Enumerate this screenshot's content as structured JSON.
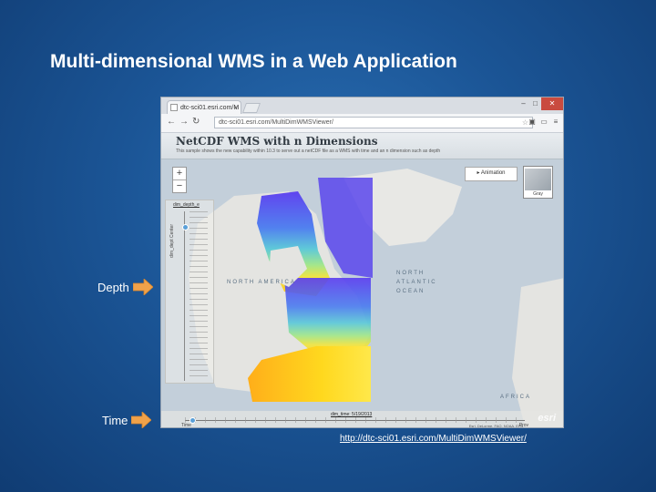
{
  "slide": {
    "title": "Multi-dimensional WMS in a Web Application",
    "depth_label": "Depth",
    "time_label": "Time",
    "link": "http://dtc-sci01.esri.com/MultiDimWMSViewer/"
  },
  "browser": {
    "tab_title": "dtc-sci01.esri.com/M",
    "address": "dtc-sci01.esri.com/MultiDimWMSViewer/",
    "window_buttons": [
      "–",
      "□",
      "✕"
    ]
  },
  "app": {
    "title": "NetCDF WMS with n Dimensions",
    "description": "This sample shows the new capability within 10.3 to serve out a netCDF file as a WMS with time and an n dimension such as depth",
    "zoom_in": "+",
    "zoom_out": "−",
    "animation_button": "▸ Animation",
    "basemap_label": "Gray",
    "depth_panel_title": "dim_depth_e",
    "depth_axis_label": "dim_dept Center",
    "time_slider_label": "dim_time: 5/19/2013",
    "time_start": "Time",
    "time_end": "Prov",
    "attribution": "Esri, DeLorme, FAO, NOAA, EPA",
    "logo": "esri",
    "map_labels": {
      "north_america": "NORTH AMERICA",
      "north_atlantic": "NORTH ATLANTIC OCEAN",
      "africa": "AFRICA"
    }
  },
  "colors": {
    "slide_bg": "#1b5596",
    "arrow": "#f0a24a",
    "data_cold": "#6a4cf0",
    "data_warm": "#ffd21a"
  }
}
